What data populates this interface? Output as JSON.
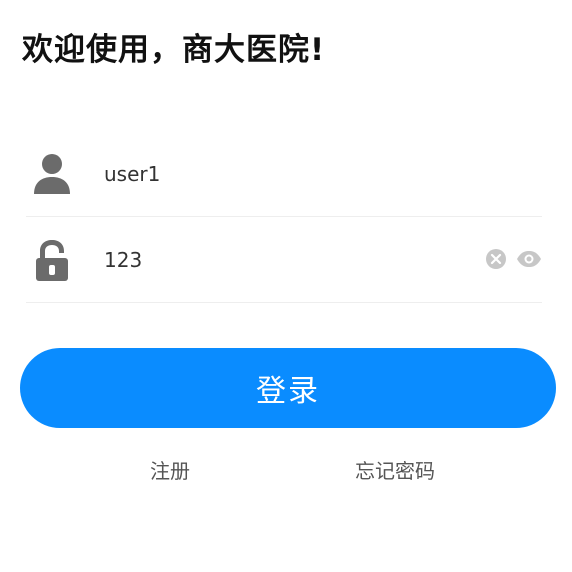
{
  "header": {
    "title": "欢迎使用，商大医院!"
  },
  "form": {
    "username": {
      "value": "user1",
      "icon": "user-icon"
    },
    "password": {
      "value": "123",
      "icon": "lock-icon",
      "clear_icon": "clear-icon",
      "visibility_icon": "eye-icon"
    }
  },
  "actions": {
    "login_label": "登录",
    "register_label": "注册",
    "forgot_password_label": "忘记密码"
  },
  "colors": {
    "primary": "#0a8cff",
    "icon_gray": "#6b6b6b",
    "link_text": "#555555",
    "divider": "#eeeeee"
  }
}
